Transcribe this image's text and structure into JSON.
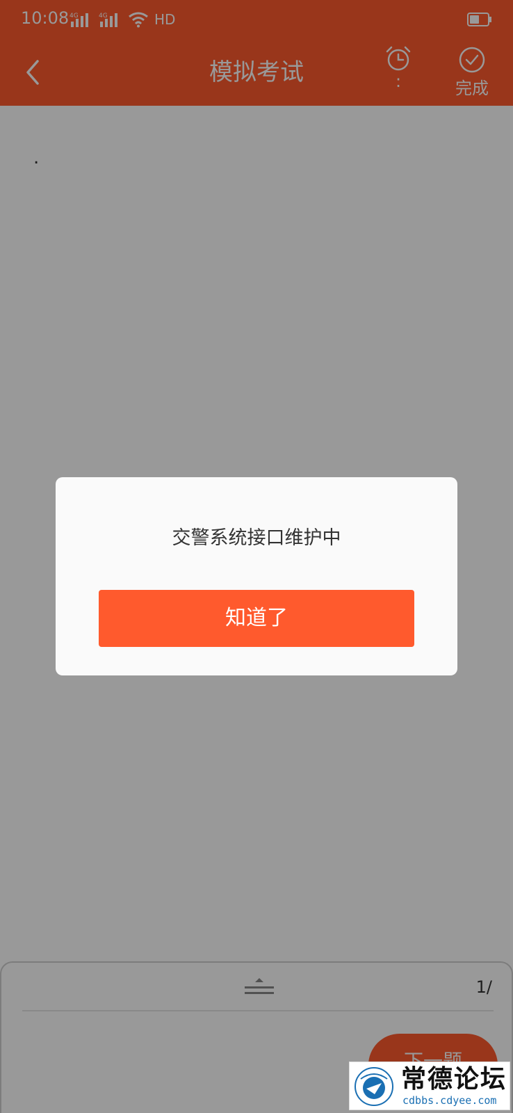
{
  "status_bar": {
    "time": "10:08",
    "signal1": "4G",
    "signal2": "4G",
    "hd": "HD"
  },
  "header": {
    "title": "模拟考试",
    "timer_text": ":",
    "done_label": "完成"
  },
  "question": {
    "text": "."
  },
  "bottom_panel": {
    "page_counter": "1/",
    "next_label": "下一题"
  },
  "dialog": {
    "message": "交警系统接口维护中",
    "button_label": "知道了"
  },
  "watermark": {
    "title": "常德论坛",
    "url": "cdbbs.cdyee.com"
  },
  "colors": {
    "accent": "#FF5A2D",
    "overlay": "rgba(0,0,0,0.4)"
  }
}
